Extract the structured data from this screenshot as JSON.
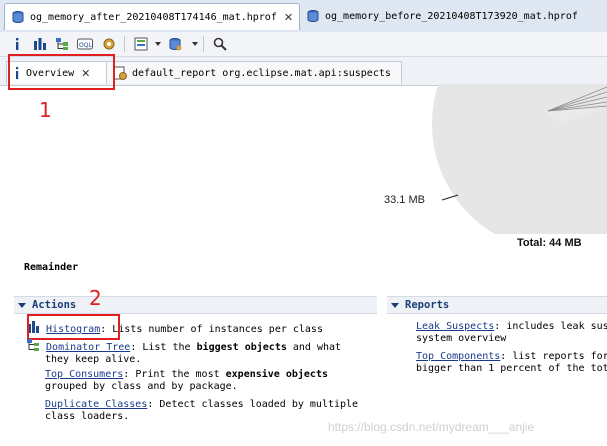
{
  "editor_tabs": [
    {
      "label": "og_memory_after_20210408T174146_mat.hprof",
      "active": true
    },
    {
      "label": "og_memory_before_20210408T173920_mat.hprof",
      "active": false
    }
  ],
  "toolbar": {
    "icons": [
      "info-icon",
      "histogram-icon",
      "dominator-tree-icon",
      "oql-icon",
      "settings-gear-icon",
      "query-browser-icon",
      "heap-dump-overview-icon",
      "search-icon"
    ]
  },
  "subtabs": [
    {
      "label": "Overview",
      "icon": "info-icon",
      "active": true
    },
    {
      "label": "default_report  org.eclipse.mat.api:suspects",
      "icon": "report-gear-icon",
      "active": false
    }
  ],
  "annotations": {
    "one": "1",
    "two": "2"
  },
  "pie": {
    "slice_label": "33.1 MB",
    "total": "Total: 44 MB",
    "colors": {
      "main": "#e6e6e6"
    }
  },
  "remainder_label": "Remainder",
  "actions": {
    "title": "Actions",
    "items": [
      {
        "link": "Histogram",
        "text1": ": Lists number of instances per class"
      },
      {
        "link": "Dominator Tree",
        "text1": ": List the ",
        "bold": "biggest objects",
        "text2": " and what",
        "line2": "they keep alive."
      },
      {
        "link": "Top Consumers",
        "text1": ": Print the most ",
        "bold": "expensive objects",
        "line2": "grouped by class and by package."
      },
      {
        "link": "Duplicate Classes",
        "text1": ": Detect classes loaded by multiple",
        "line2": "class loaders."
      }
    ]
  },
  "reports": {
    "title": "Reports",
    "items": [
      {
        "link": "Leak Suspects",
        "text1": ": includes leak sus",
        "line2": "system overview"
      },
      {
        "link": "Top Components",
        "text1": ": list reports for",
        "line2": "bigger than 1 percent of the tot"
      }
    ]
  },
  "watermark": "https://blog.csdn.net/mydream___anjie"
}
